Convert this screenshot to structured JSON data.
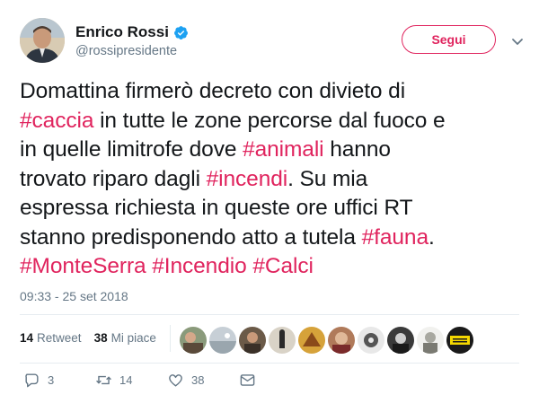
{
  "author": {
    "display_name": "Enrico Rossi",
    "handle": "@rossipresidente",
    "verified": true
  },
  "follow_button_label": "Segui",
  "tweet": {
    "segments": [
      [
        {
          "text": "Domattina firmerò decreto con divieto di",
          "hashtag": false
        }
      ],
      [
        {
          "text": "#caccia",
          "hashtag": true
        },
        {
          "text": " in tutte le zone percorse dal fuoco e",
          "hashtag": false
        }
      ],
      [
        {
          "text": "in quelle limitrofe dove ",
          "hashtag": false
        },
        {
          "text": "#animali",
          "hashtag": true
        },
        {
          "text": " hanno",
          "hashtag": false
        }
      ],
      [
        {
          "text": "trovato riparo dagli ",
          "hashtag": false
        },
        {
          "text": "#incendi",
          "hashtag": true
        },
        {
          "text": ". Su mia",
          "hashtag": false
        }
      ],
      [
        {
          "text": "espressa richiesta in queste ore uffici RT",
          "hashtag": false
        }
      ],
      [
        {
          "text": "stanno predisponendo atto a tutela ",
          "hashtag": false
        },
        {
          "text": "#fauna",
          "hashtag": true
        },
        {
          "text": ".",
          "hashtag": false
        }
      ],
      [
        {
          "text": "#MonteSerra",
          "hashtag": true
        },
        {
          "text": " ",
          "hashtag": false
        },
        {
          "text": "#Incendio",
          "hashtag": true
        },
        {
          "text": " ",
          "hashtag": false
        },
        {
          "text": "#Calci",
          "hashtag": true
        }
      ]
    ],
    "timestamp": "09:33 - 25 set 2018"
  },
  "stats": {
    "retweets_count": "14",
    "retweets_label": "Retweet",
    "likes_count": "38",
    "likes_label": "Mi piace"
  },
  "actions": {
    "reply_count": "3",
    "retweet_count": "14",
    "like_count": "38"
  },
  "colors": {
    "accent": "#e0245e",
    "muted": "#657786",
    "text": "#14171a",
    "verified": "#1da1f2"
  },
  "icons": {
    "verified": "verified-badge-icon",
    "chevron": "chevron-down-icon",
    "reply": "reply-icon",
    "retweet": "retweet-icon",
    "like": "heart-icon",
    "message": "envelope-icon"
  }
}
